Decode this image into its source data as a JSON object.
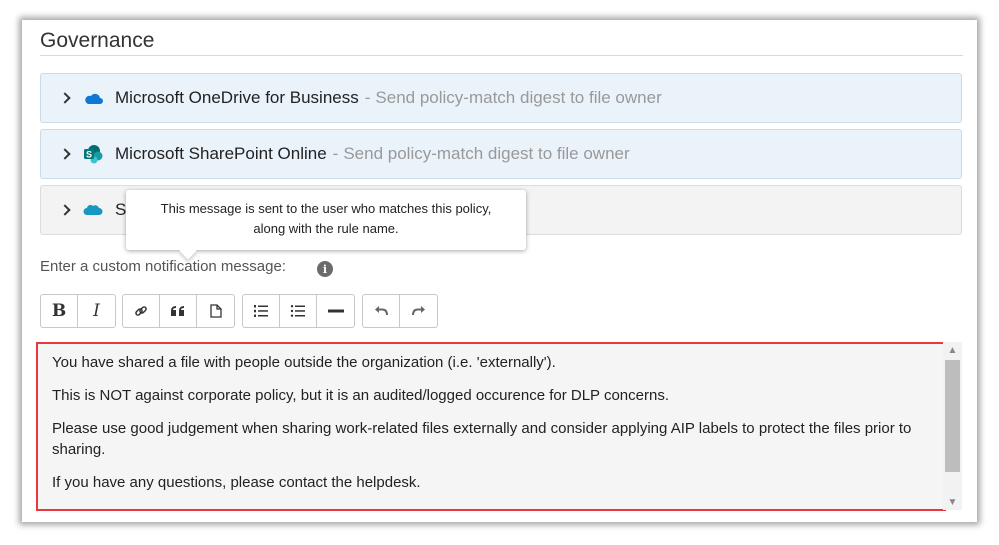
{
  "section": {
    "title": "Governance"
  },
  "panels": [
    {
      "name": "Microsoft OneDrive for Business",
      "separator": "-",
      "description": "Send policy-match digest to file owner",
      "icon": "onedrive-cloud-icon"
    },
    {
      "name": "Microsoft SharePoint Online",
      "separator": "-",
      "description": "Send policy-match digest to file owner",
      "icon": "sharepoint-icon"
    },
    {
      "name": "Sa",
      "icon": "salesforce-cloud-icon"
    }
  ],
  "tooltip": {
    "line1": "This message is sent to the user who matches this policy,",
    "line2": "along with the rule name."
  },
  "notification": {
    "label": "Enter a custom notification message:",
    "info_icon": "info-icon"
  },
  "toolbar": {
    "bold": "B",
    "italic": "I",
    "icons": [
      "link-icon",
      "quote-icon",
      "document-icon",
      "numbered-list-icon",
      "bulleted-list-icon",
      "horizontal-rule-icon",
      "undo-icon",
      "redo-icon"
    ]
  },
  "editor": {
    "paragraphs": [
      "You have shared a file with people outside the organization (i.e. 'externally').",
      "This is NOT against corporate policy, but it is an audited/logged occurence for DLP concerns.",
      "Please use good judgement when sharing work-related files externally and consider applying AIP labels to protect the files prior to sharing.",
      "If you have any questions, please contact the helpdesk."
    ]
  },
  "colors": {
    "highlight_border": "#e8383e",
    "panel_blue": "#eaf3fa",
    "onedrive": "#0f78d4",
    "sharepoint": "#03787c",
    "salesforce": "#1798c1"
  }
}
